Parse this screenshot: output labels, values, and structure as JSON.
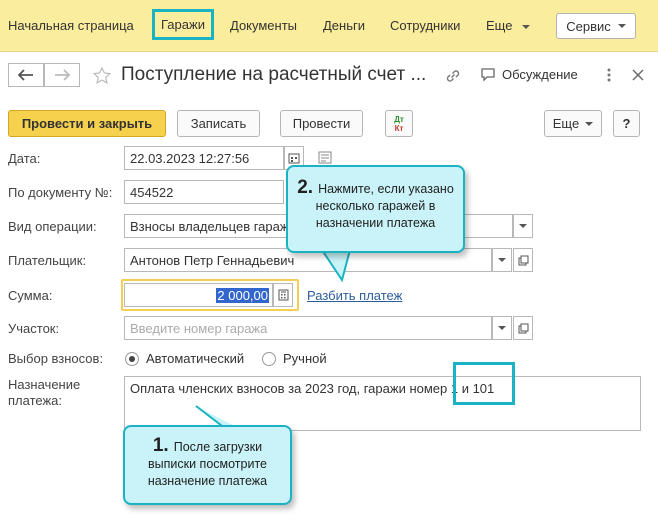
{
  "nav": {
    "items": [
      "Начальная страница",
      "Гаражи",
      "Документы",
      "Деньги",
      "Сотрудники",
      "Еще"
    ],
    "service": "Сервис"
  },
  "header": {
    "title": "Поступление на расчетный счет ...",
    "discussion": "Обсуждение"
  },
  "toolbar": {
    "post_close": "Провести и закрыть",
    "save": "Записать",
    "post": "Провести",
    "dt_label": "Дт",
    "kt_label": "Кт",
    "more": "Еще",
    "help": "?"
  },
  "form": {
    "date_label": "Дата:",
    "date_value": "22.03.2023 12:27:56",
    "doc_label": "По документу №:",
    "doc_value": "454522",
    "op_label": "Вид операции:",
    "op_value": "Взносы владельцев гараж",
    "payer_label": "Плательщик:",
    "payer_value": "Антонов Петр Геннадьевич",
    "sum_label": "Сумма:",
    "sum_value": "2 000,00",
    "split_link": "Разбить платеж",
    "site_label": "Участок:",
    "site_placeholder": "Введите номер гаража",
    "fees_label": "Выбор взносов:",
    "fees_auto": "Автоматический",
    "fees_manual": "Ручной",
    "purpose_label_1": "Назначение",
    "purpose_label_2": "платежа:",
    "purpose_value": "Оплата членских взносов за 2023 год, гаражи номер 1 и 101"
  },
  "callouts": {
    "one_num": "1.",
    "one_l1": "После загрузки",
    "one_l2": "выписки посмотрите",
    "one_l3": "назначение платежа",
    "two_num": "2.",
    "two_l1": "Нажмите, если указано",
    "two_l2": "несколько гаражей в",
    "two_l3": "назначении платежа"
  },
  "colors": {
    "nav_bg": "#fbed9e",
    "accent": "#1bb3c4",
    "callout_bg": "#c9f3f8",
    "primary_button": "#f6d14d",
    "link": "#2b5d9b"
  }
}
